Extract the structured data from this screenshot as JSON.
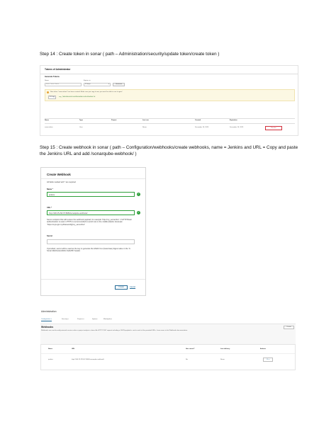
{
  "step14": {
    "heading": "Step 14 : Create token in sonar ( path – Administration/security/update token/create token )",
    "tokens_title": "Tokens of Administrator",
    "generate_title": "Generate Tokens",
    "name_label": "Name",
    "expires_label": "Expires in",
    "name_placeholder": "Enter Token Name",
    "expires_value": "30 days",
    "generate_button": "Generate",
    "notice": "New token \"sonar-token\" has been created. Make sure you copy it now, you won't be able to see it again!",
    "copy_button": "Copy",
    "token_value": "squ_7d8e9f4e0a2b1c6d3f5e8a9b0c1d2e3f4a5b6c7d",
    "columns": [
      "Name",
      "Type",
      "Project",
      "Last use",
      "Created",
      "Expiration"
    ],
    "row": {
      "name": "sonar-token",
      "type": "User",
      "project": "",
      "last_use": "Never",
      "created": "December 16, 2023",
      "expiration": "December 16, 2023"
    },
    "revoke_button": "Revoke"
  },
  "step15": {
    "heading": "Step 15 : Create webhook in sonar ( path – Configuration/webhooks/create webhooks, name = Jenkins and URL = Copy and paste the Jenkins URL and add /sonarqube-webhook/ )",
    "dialog_title": "Create Webhook",
    "required_note": "All fields marked with * are required",
    "name_label": "Name *",
    "name_value": "jenkins",
    "url_label": "URL *",
    "url_value": "http://100.25.293.67:8080/sonarqube-webhook/",
    "url_help": "Server endpoint that will receive the webhook payload, for example \"http://my_server/foo\". If HTTP Basic authentication is used, HTTPS is recommended to avoid man in the middle attacks. Example: \"https://myLogin:myPassword@my_server/foo\"",
    "secret_label": "Secret",
    "secret_help": "If provided, secret will be used as the key to generate the HMAC hex (lowercase) digest value in the 'X-Sonar-Webhook-HMAC-SHA256' header.",
    "create_button": "Create",
    "cancel_link": "Cancel"
  },
  "admin": {
    "title": "Administration",
    "tabs": [
      "Configuration ▾",
      "Security ▾",
      "Projects ▾",
      "System",
      "Marketplace"
    ],
    "webhooks_title": "Webhooks",
    "create_button": "Create",
    "description": "Webhooks are used to notify external services when a project analysis is done. An HTTP POST request including a JSON payload is sent to each of the provided URLs. Learn more in the Webhooks documentation.",
    "columns": [
      "Name",
      "URL",
      "Has secret?",
      "Last delivery",
      "Actions"
    ],
    "row": {
      "name": "jenkins",
      "url": "http://100.25.293.67:8080/sonarqube-webhook/",
      "has_secret": "No",
      "last_delivery": "Never",
      "actions": "⚙ ▾"
    }
  },
  "colors": {
    "success": "#2e9f3a",
    "revoke": "#d02f3a",
    "link": "#236a97",
    "notice_bg": "#fcf8e3"
  }
}
